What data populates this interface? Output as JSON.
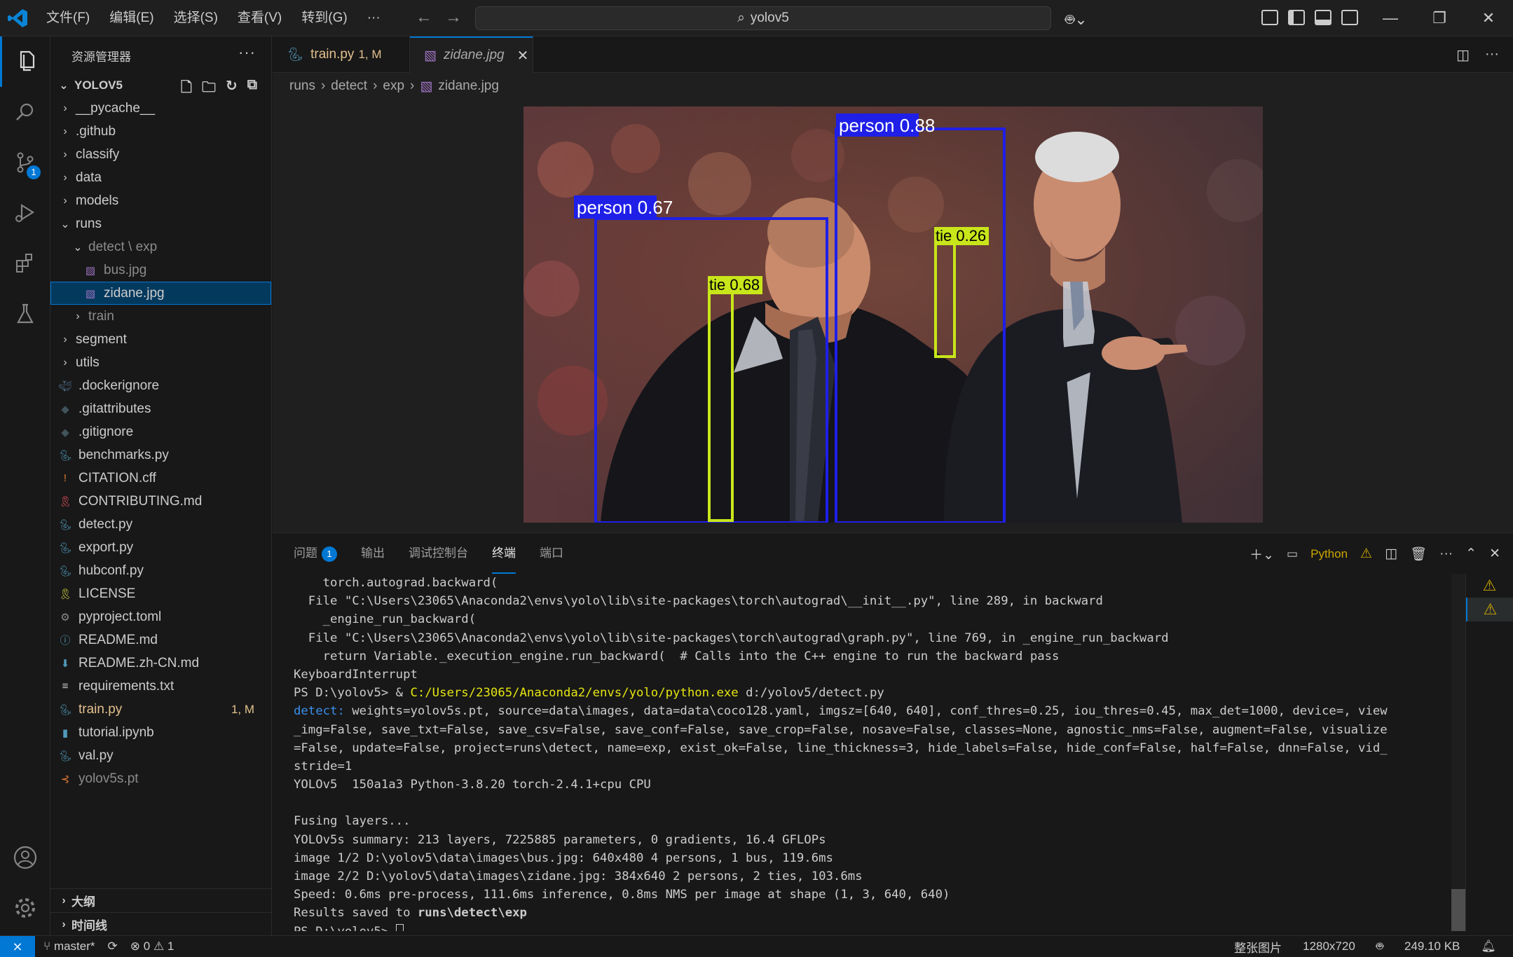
{
  "titlebar": {
    "menu": [
      "文件(F)",
      "编辑(E)",
      "选择(S)",
      "查看(V)",
      "转到(G)",
      "···"
    ],
    "search": "yolov5",
    "win": [
      "—",
      "❐",
      "✕"
    ]
  },
  "activitybar": {
    "scm_badge": "1"
  },
  "sidebar": {
    "title": "资源管理器",
    "more": "···",
    "root": "YOLOV5",
    "tree": [
      {
        "label": "__pycache__",
        "type": "folder",
        "depth": 1,
        "open": false
      },
      {
        "label": ".github",
        "type": "folder",
        "depth": 1,
        "open": false
      },
      {
        "label": "classify",
        "type": "folder",
        "depth": 1,
        "open": false
      },
      {
        "label": "data",
        "type": "folder",
        "depth": 1,
        "open": false
      },
      {
        "label": "models",
        "type": "folder",
        "depth": 1,
        "open": false
      },
      {
        "label": "runs",
        "type": "folder",
        "depth": 1,
        "open": true
      },
      {
        "label": "detect \\ exp",
        "type": "folder",
        "depth": 2,
        "open": true,
        "dim": true
      },
      {
        "label": "bus.jpg",
        "type": "image",
        "depth": 3,
        "dim": true
      },
      {
        "label": "zidane.jpg",
        "type": "image",
        "depth": 3,
        "selected": true
      },
      {
        "label": "train",
        "type": "folder",
        "depth": 2,
        "open": false,
        "dim": true
      },
      {
        "label": "segment",
        "type": "folder",
        "depth": 1,
        "open": false
      },
      {
        "label": "utils",
        "type": "folder",
        "depth": 1,
        "open": false
      },
      {
        "label": ".dockerignore",
        "type": "docker",
        "depth": 1
      },
      {
        "label": ".gitattributes",
        "type": "git",
        "depth": 1
      },
      {
        "label": ".gitignore",
        "type": "git",
        "depth": 1
      },
      {
        "label": "benchmarks.py",
        "type": "python",
        "depth": 1
      },
      {
        "label": "CITATION.cff",
        "type": "excl",
        "depth": 1
      },
      {
        "label": "CONTRIBUTING.md",
        "type": "ribbon",
        "depth": 1
      },
      {
        "label": "detect.py",
        "type": "python",
        "depth": 1
      },
      {
        "label": "export.py",
        "type": "python",
        "depth": 1
      },
      {
        "label": "hubconf.py",
        "type": "python",
        "depth": 1
      },
      {
        "label": "LICENSE",
        "type": "license",
        "depth": 1
      },
      {
        "label": "pyproject.toml",
        "type": "gear",
        "depth": 1
      },
      {
        "label": "README.md",
        "type": "info",
        "depth": 1
      },
      {
        "label": "README.zh-CN.md",
        "type": "down",
        "depth": 1
      },
      {
        "label": "requirements.txt",
        "type": "lines",
        "depth": 1
      },
      {
        "label": "train.py",
        "type": "python",
        "depth": 1,
        "modified": true,
        "suffix": "1, M"
      },
      {
        "label": "tutorial.ipynb",
        "type": "notebook",
        "depth": 1
      },
      {
        "label": "val.py",
        "type": "python",
        "depth": 1
      },
      {
        "label": "yolov5s.pt",
        "type": "rss",
        "depth": 1,
        "dim": true
      }
    ],
    "outline": "大纲",
    "timeline": "时间线"
  },
  "tabs": [
    {
      "label": "train.py",
      "suffix": "1, M"
    },
    {
      "label": "zidane.jpg",
      "close": "✕"
    }
  ],
  "breadcrumb": [
    "runs",
    "detect",
    "exp",
    "zidane.jpg"
  ],
  "detections": [
    {
      "label": "person 0.67"
    },
    {
      "label": "person 0.88"
    },
    {
      "label": "tie 0.68"
    },
    {
      "label": "tie 0.26"
    }
  ],
  "panel": {
    "tabs": [
      "问题",
      "输出",
      "调试控制台",
      "终端",
      "端口"
    ],
    "problems_badge": "1",
    "shell": "Python"
  },
  "terminal": [
    {
      "parts": [
        {
          "t": "    torch.autograd.backward("
        }
      ]
    },
    {
      "parts": [
        {
          "t": "  File \"C:\\Users\\23065\\Anaconda2\\envs\\yolo\\lib\\site-packages\\torch\\autograd\\__init__.py\", line 289, in backward"
        }
      ]
    },
    {
      "parts": [
        {
          "t": "    _engine_run_backward("
        }
      ]
    },
    {
      "parts": [
        {
          "t": "  File \"C:\\Users\\23065\\Anaconda2\\envs\\yolo\\lib\\site-packages\\torch\\autograd\\graph.py\", line 769, in _engine_run_backward"
        }
      ]
    },
    {
      "parts": [
        {
          "t": "    return Variable._execution_engine.run_backward(  # Calls into the C++ engine to run the backward pass"
        }
      ]
    },
    {
      "parts": [
        {
          "t": "KeyboardInterrupt"
        }
      ]
    },
    {
      "parts": [
        {
          "t": "PS D:\\yolov5> & "
        },
        {
          "t": "C:/Users/23065/Anaconda2/envs/yolo/python.exe",
          "c": "t-yellow"
        },
        {
          "t": " d:/yolov5/detect.py"
        }
      ]
    },
    {
      "parts": [
        {
          "t": "detect: ",
          "c": "t-blue"
        },
        {
          "t": "weights=yolov5s.pt, source=data\\images, data=data\\coco128.yaml, imgsz=[640, 640], conf_thres=0.25, iou_thres=0.45, max_det=1000, device=, view"
        }
      ]
    },
    {
      "parts": [
        {
          "t": "_img=False, save_txt=False, save_csv=False, save_conf=False, save_crop=False, nosave=False, classes=None, agnostic_nms=False, augment=False, visualize"
        }
      ]
    },
    {
      "parts": [
        {
          "t": "=False, update=False, project=runs\\detect, name=exp, exist_ok=False, line_thickness=3, hide_labels=False, hide_conf=False, half=False, dnn=False, vid_"
        }
      ]
    },
    {
      "parts": [
        {
          "t": "stride=1"
        }
      ]
    },
    {
      "parts": [
        {
          "t": "YOLOv5  150a1a3 Python-3.8.20 torch-2.4.1+cpu CPU"
        }
      ]
    },
    {
      "parts": [
        {
          "t": ""
        }
      ]
    },
    {
      "parts": [
        {
          "t": "Fusing layers..."
        }
      ]
    },
    {
      "parts": [
        {
          "t": "YOLOv5s summary: 213 layers, 7225885 parameters, 0 gradients, 16.4 GFLOPs"
        }
      ]
    },
    {
      "parts": [
        {
          "t": "image 1/2 D:\\yolov5\\data\\images\\bus.jpg: 640x480 4 persons, 1 bus, 119.6ms"
        }
      ]
    },
    {
      "parts": [
        {
          "t": "image 2/2 D:\\yolov5\\data\\images\\zidane.jpg: 384x640 2 persons, 2 ties, 103.6ms"
        }
      ]
    },
    {
      "parts": [
        {
          "t": "Speed: 0.6ms pre-process, 111.6ms inference, 0.8ms NMS per image at shape (1, 3, 640, 640)"
        }
      ]
    },
    {
      "parts": [
        {
          "t": "Results saved to "
        },
        {
          "t": "runs\\detect\\exp",
          "c": "t-bold"
        }
      ]
    },
    {
      "parts": [
        {
          "t": "PS D:\\yolov5> "
        }
      ],
      "cursor": true
    }
  ],
  "statusbar": {
    "branch": "master*",
    "errors": "0",
    "warnings": "1",
    "image_type": "整张图片",
    "dimensions": "1280x720",
    "size": "249.10 KB"
  },
  "colors": {
    "accent": "#0078d4",
    "person_box": "#1f1fe8",
    "tie_box": "#c8e61a",
    "modified": "#e2c08d",
    "python_icon": "#519aba"
  }
}
